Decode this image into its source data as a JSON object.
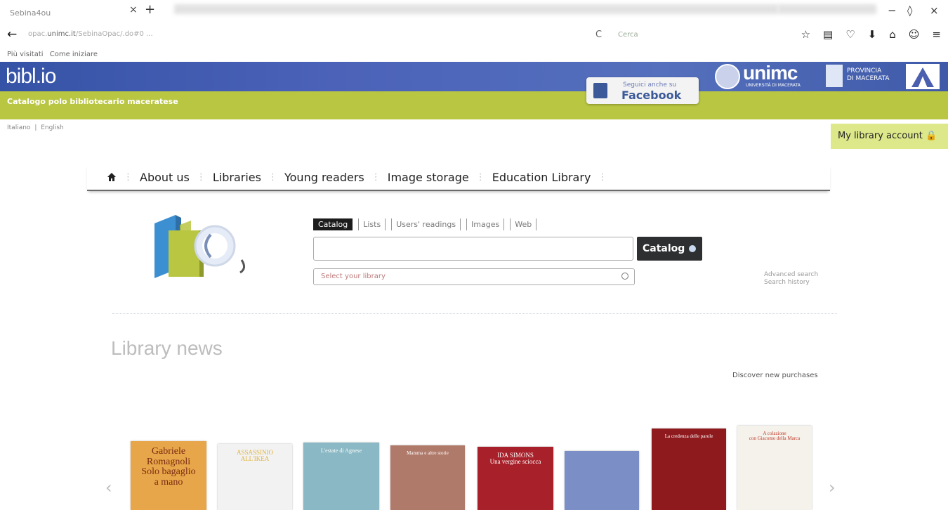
{
  "browser": {
    "tab_title": "Sebina4ou",
    "tab_close": "×",
    "new_tab": "+",
    "window_controls": [
      "−",
      "◊",
      "×"
    ],
    "back_icon": "←",
    "url_host_prefix": "opac.",
    "url_domain": "unimc.it",
    "url_path": "/SebinaOpac/.do#0  ...",
    "reload_icon": "C",
    "search_placeholder": "Cerca",
    "toolbar_icons": [
      "star-icon",
      "clipboard-icon",
      "pocket-icon",
      "download-icon",
      "home-icon",
      "smiley-icon",
      "menu-icon"
    ],
    "toolbar_glyphs": [
      "☆",
      "▤",
      "♡",
      "⬇",
      "⌂",
      "☺",
      "≡"
    ]
  },
  "bookmarks": [
    "Più visitati",
    "Come iniziare"
  ],
  "header": {
    "logo": "bibl.io",
    "subtitle": "Catalogo polo bibliotecario maceratese",
    "facebook_small": "Seguici anche su",
    "facebook_big": "Facebook",
    "unimc": "unimc",
    "unimc_sub": "UNIVERSITÀ DI MACERATA",
    "provincia": "PROVINCIA\nDI MACERATA",
    "account": "My library account"
  },
  "languages": [
    "Italiano",
    "|",
    "English"
  ],
  "nav": {
    "items": [
      "About us",
      "Libraries",
      "Young readers",
      "Image storage",
      "Education Library"
    ]
  },
  "search": {
    "tabs": [
      "Catalog",
      "Lists",
      "Users' readings",
      "Images",
      "Web"
    ],
    "active_tab": "Catalog",
    "query": "",
    "button": "Catalog",
    "library_placeholder": "Select your library",
    "advanced": "Advanced search",
    "history": "Search history"
  },
  "news": {
    "title": "Library news",
    "discover": "Discover new purchases",
    "prev": "‹",
    "next": "›",
    "books": [
      {
        "title": "Gabriele Romagnoli\nSolo bagaglio\na mano",
        "color": "#e8a64a",
        "text_color": "#7a2b10"
      },
      {
        "title": "ASSASSINIO ALL'IKEA",
        "color": "#f2f2f2",
        "text_color": "#e0b33a"
      },
      {
        "title": "L'estate di Agnese",
        "color": "#8ab8c4",
        "text_color": "#ffffff"
      },
      {
        "title": "Mamma e altre storie",
        "color": "#b07a6a",
        "text_color": "#ffffff"
      },
      {
        "title": "IDA SIMONS\nUna vergine sciocca",
        "color": "#a8212a",
        "text_color": "#ffffff"
      },
      {
        "title": "",
        "color": "#7b8fc6",
        "text_color": "#ffffff"
      },
      {
        "title": "La credenza delle parole",
        "color": "#8e1a1e",
        "text_color": "#ffffff"
      },
      {
        "title": "A colazione\ncon Giacomo della Marca",
        "color": "#f4f2ea",
        "text_color": "#c0392b"
      }
    ]
  }
}
